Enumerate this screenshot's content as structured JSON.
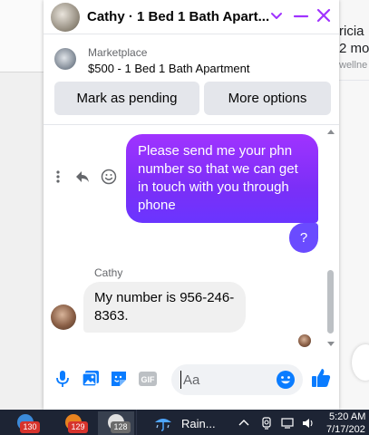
{
  "background": {
    "right_text_1": "ricia",
    "right_text_2": "2 mo",
    "right_text_3": "wellne"
  },
  "header": {
    "title": "Cathy · 1 Bed 1 Bath Apart...",
    "accent_color": "#a033ff",
    "icons": [
      "chevron-down-icon",
      "minimize-icon",
      "close-icon"
    ]
  },
  "marketplace": {
    "label": "Marketplace",
    "listing": "$500 - 1 Bed 1 Bath Apartment"
  },
  "actions": {
    "pending_label": "Mark as pending",
    "more_label": "More options"
  },
  "messages": {
    "outgoing_1": "Please send me your phn number so that we can get in touch with you through phone",
    "outgoing_2": "?",
    "sender_name": "Cathy",
    "incoming_1": "My number is 956-246-8363."
  },
  "composer": {
    "placeholder": "Aa",
    "gif_label": "GIF"
  },
  "taskbar": {
    "badges": [
      "130",
      "129",
      "128"
    ],
    "weather": "Rain...",
    "time": "5:20 AM",
    "date": "7/17/202"
  }
}
